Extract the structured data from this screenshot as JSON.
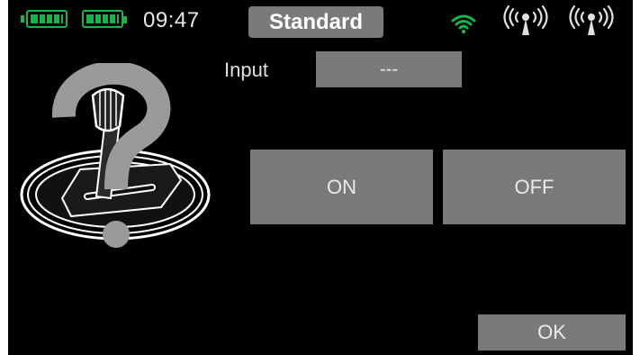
{
  "status": {
    "time": "09:47",
    "model_name": "Standard",
    "battery_count": 2,
    "wifi_color": "#19b34a",
    "battery_color": "#19b34a",
    "icons": [
      "battery-icon",
      "battery-icon",
      "wifi-icon",
      "antenna-icon",
      "antenna-icon"
    ]
  },
  "form": {
    "input_label": "Input",
    "input_value": "---"
  },
  "buttons": {
    "on": "ON",
    "off": "OFF",
    "ok": "OK"
  },
  "colors": {
    "background": "#000000",
    "button": "#7a7a7a",
    "text": "#eaeaea"
  }
}
